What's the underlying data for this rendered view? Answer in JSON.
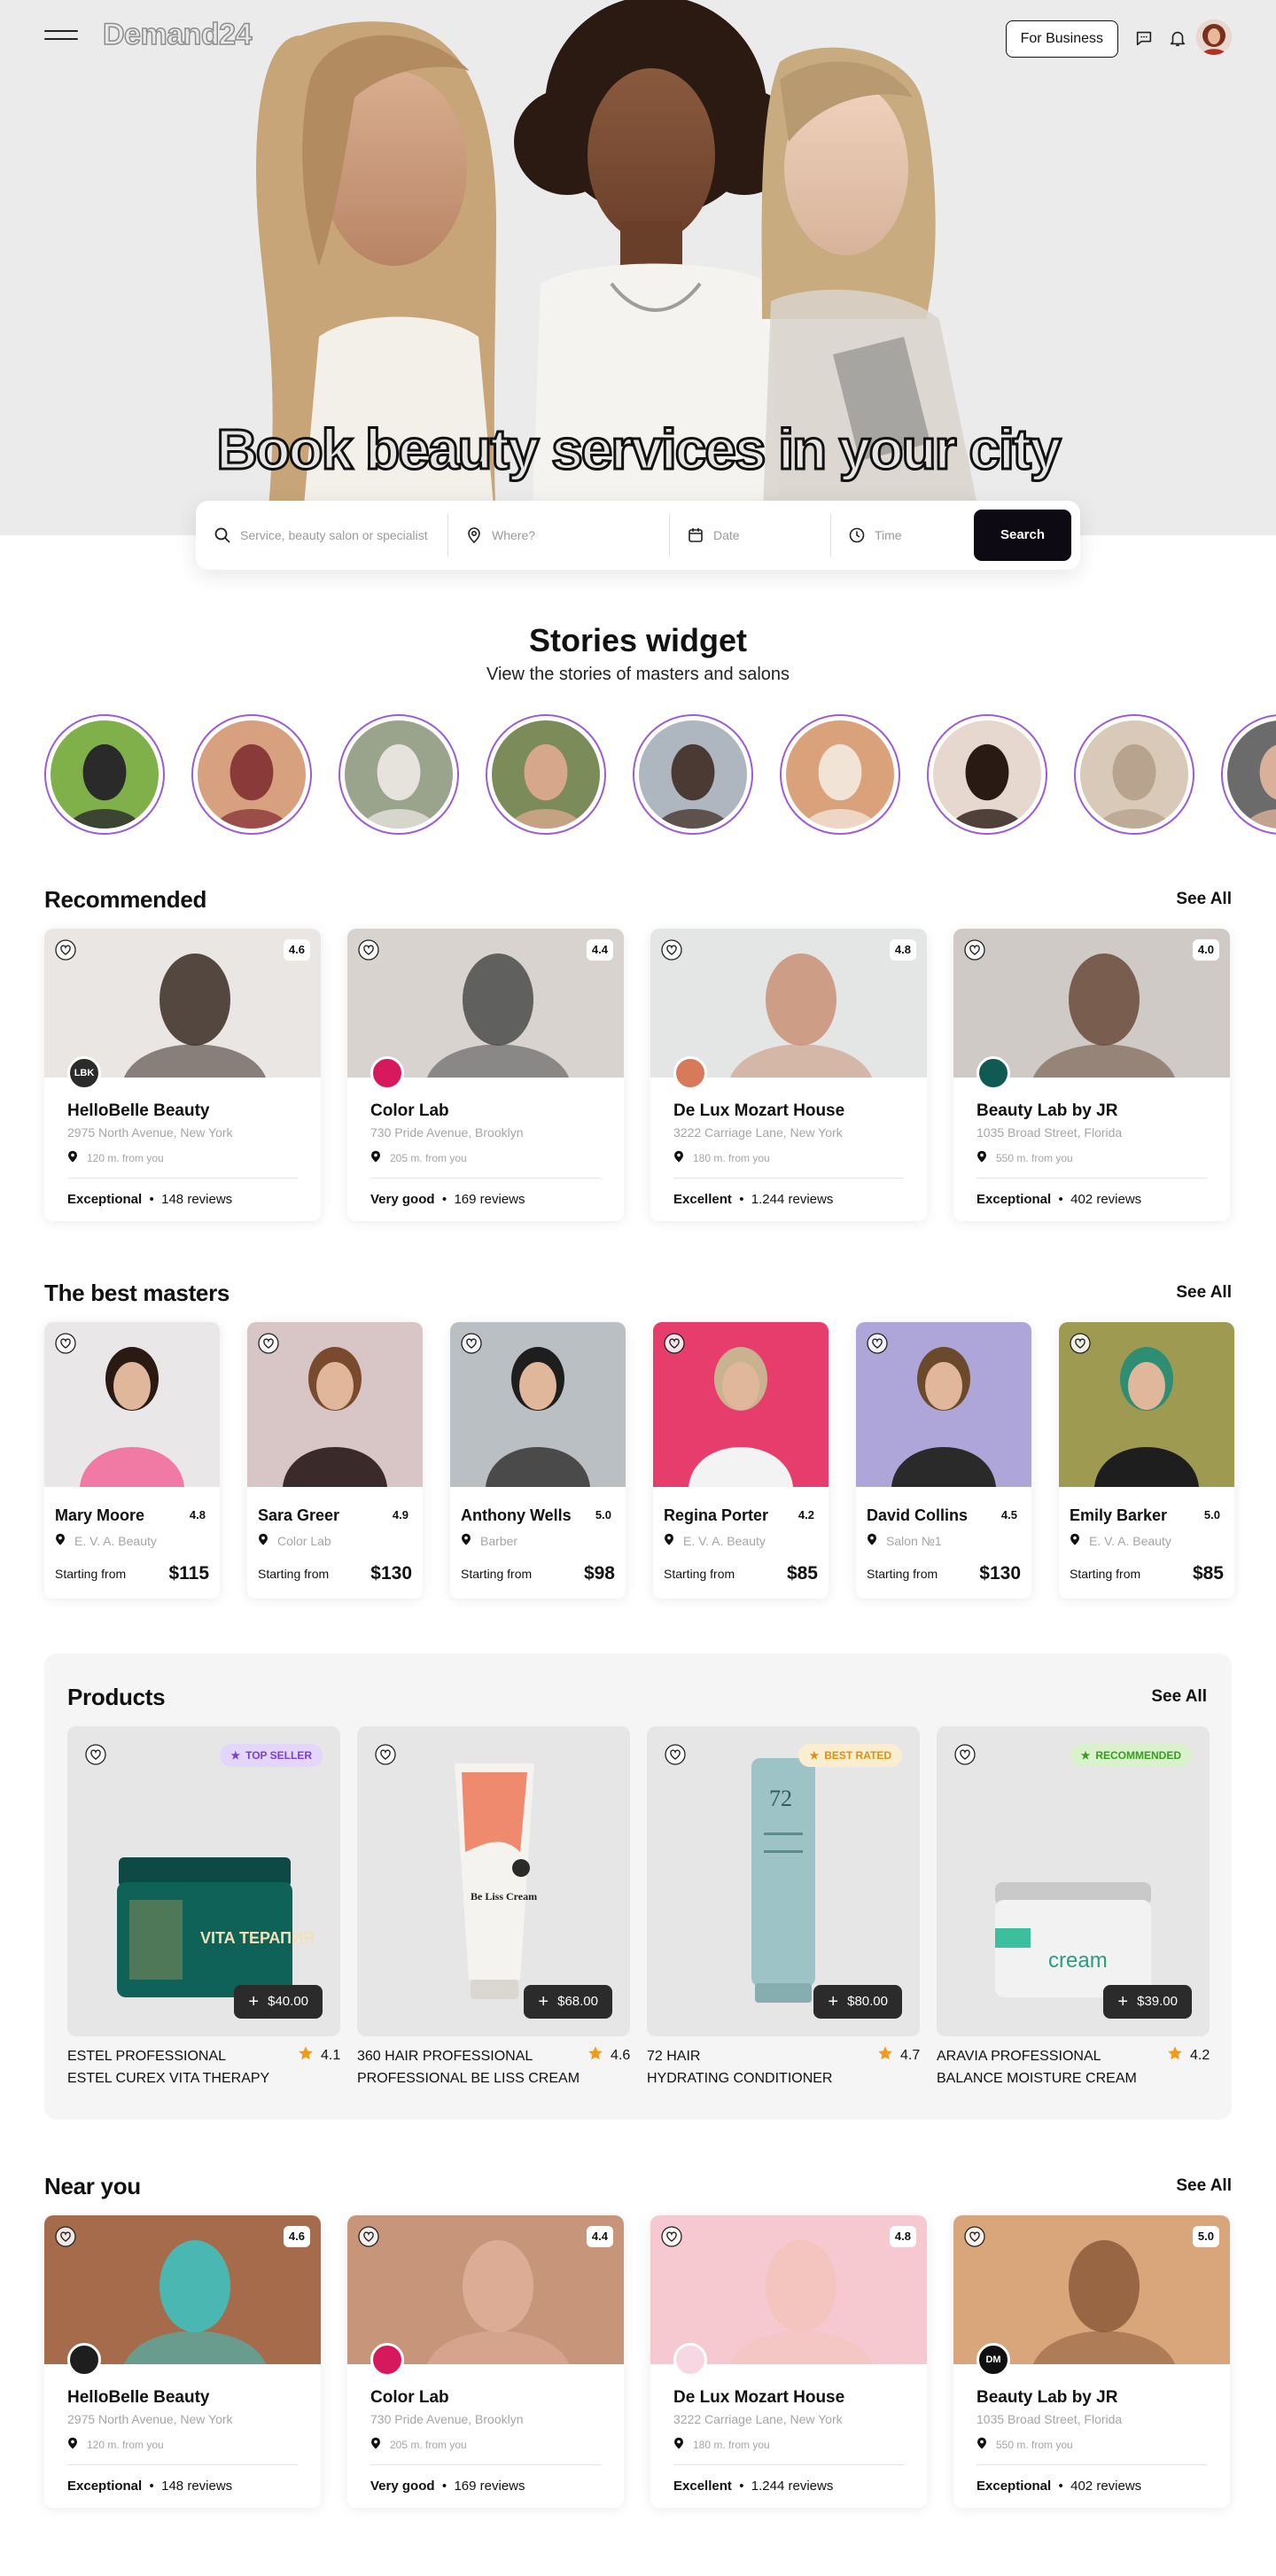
{
  "brand": {
    "logo": "Demand24"
  },
  "nav": {
    "for_business": "For Business"
  },
  "hero": {
    "title": "Book beauty services in your city"
  },
  "search": {
    "service_placeholder": "Service, beauty salon or specialist",
    "where_placeholder": "Where?",
    "date_placeholder": "Date",
    "time_placeholder": "Time",
    "button": "Search"
  },
  "stories": {
    "title": "Stories widget",
    "subtitle": "View the stories of masters and salons"
  },
  "recommended": {
    "title": "Recommended",
    "see_all": "See All",
    "cards": [
      {
        "name": "HelloBelle Beauty",
        "address": "2975 North Avenue, New York",
        "distance": "120 m. from you",
        "rating": "4.6",
        "rating_word": "Exceptional",
        "reviews": "148 reviews",
        "logo": "LBK",
        "logo_color": "#2b2b2b"
      },
      {
        "name": "Color Lab",
        "address": "730 Pride Avenue, Brooklyn",
        "distance": "205 m. from you",
        "rating": "4.4",
        "rating_word": "Very good",
        "reviews": "169 reviews",
        "logo": "",
        "logo_color": "#d8185c"
      },
      {
        "name": "De Lux Mozart House",
        "address": "3222 Carriage Lane, New York",
        "distance": "180 m. from you",
        "rating": "4.8",
        "rating_word": "Excellent",
        "reviews": "1.244 reviews",
        "logo": "",
        "logo_color": "#d77a5a"
      },
      {
        "name": "Beauty Lab by JR",
        "address": "1035 Broad Street, Florida",
        "distance": "550 m. from you",
        "rating": "4.0",
        "rating_word": "Exceptional",
        "reviews": "402 reviews",
        "logo": "",
        "logo_color": "#0f5a52"
      }
    ]
  },
  "masters": {
    "title": "The best masters",
    "see_all": "See All",
    "from_label": "Starting from",
    "cards": [
      {
        "name": "Mary Moore",
        "rating": "4.8",
        "salon": "E. V. A. Beauty",
        "price": "$115",
        "bg": "#e9e7e8"
      },
      {
        "name": "Sara Greer",
        "rating": "4.9",
        "salon": "Color Lab",
        "price": "$130",
        "bg": "#d8c6c7"
      },
      {
        "name": "Anthony Wells",
        "rating": "5.0",
        "salon": "Barber",
        "price": "$98",
        "bg": "#b9bfc3"
      },
      {
        "name": "Regina Porter",
        "rating": "4.2",
        "salon": "E. V. A. Beauty",
        "price": "$85",
        "bg": "#e63d6c"
      },
      {
        "name": "David Collins",
        "rating": "4.5",
        "salon": "Salon №1",
        "price": "$130",
        "bg": "#aea5d9"
      },
      {
        "name": "Emily Barker",
        "rating": "5.0",
        "salon": "E. V. A. Beauty",
        "price": "$85",
        "bg": "#9e9a52"
      }
    ]
  },
  "products": {
    "title": "Products",
    "see_all": "See All",
    "items": [
      {
        "brand": "ESTEL PROFESSIONAL",
        "name": "ESTEL CUREX VITA THERAPY",
        "rating": "4.1",
        "price": "$40.00",
        "tag": "TOP SELLER",
        "tag_color": "#7b3fd1",
        "tag_bg": "#e4d6fb",
        "jar_text": "VITA ТЕРАПИЯ"
      },
      {
        "brand": "360 HAIR PROFESSIONAL",
        "name": "PROFESSIONAL BE LISS CREAM",
        "rating": "4.6",
        "price": "$68.00",
        "tag": "",
        "tag_color": "",
        "tag_bg": "",
        "tube_text": "Be Liss Cream"
      },
      {
        "brand": "72 HAIR",
        "name": "HYDRATING CONDITIONER",
        "rating": "4.7",
        "price": "$80.00",
        "tag": "BEST RATED",
        "tag_color": "#d99212",
        "tag_bg": "#fbedd0",
        "tube_text": "72"
      },
      {
        "brand": "ARAVIA PROFESSIONAL",
        "name": "BALANCE MOISTURE CREAM",
        "rating": "4.2",
        "price": "$39.00",
        "tag": "RECOMMENDED",
        "tag_color": "#3a9a22",
        "tag_bg": "#d9f2cc",
        "jar_text": "cream"
      }
    ]
  },
  "near": {
    "title": "Near you",
    "see_all": "See All",
    "cards": [
      {
        "name": "HelloBelle Beauty",
        "address": "2975 North Avenue, New York",
        "distance": "120 m. from you",
        "rating": "4.6",
        "rating_word": "Exceptional",
        "reviews": "148 reviews",
        "logo": "",
        "logo_color": "#1e1e1e"
      },
      {
        "name": "Color Lab",
        "address": "730 Pride Avenue, Brooklyn",
        "distance": "205 m. from you",
        "rating": "4.4",
        "rating_word": "Very good",
        "reviews": "169 reviews",
        "logo": "",
        "logo_color": "#d8185c"
      },
      {
        "name": "De Lux Mozart House",
        "address": "3222 Carriage Lane, New York",
        "distance": "180 m. from you",
        "rating": "4.8",
        "rating_word": "Excellent",
        "reviews": "1.244 reviews",
        "logo": "",
        "logo_color": "#f7d7e2"
      },
      {
        "name": "Beauty Lab by JR",
        "address": "1035 Broad Street, Florida",
        "distance": "550 m. from you",
        "rating": "5.0",
        "rating_word": "Exceptional",
        "reviews": "402 reviews",
        "logo": "DM",
        "logo_color": "#111111"
      }
    ]
  },
  "colors": {
    "accent": "#0d0a14",
    "story_ring": "#9b5cd6",
    "star": "#f29b19"
  }
}
